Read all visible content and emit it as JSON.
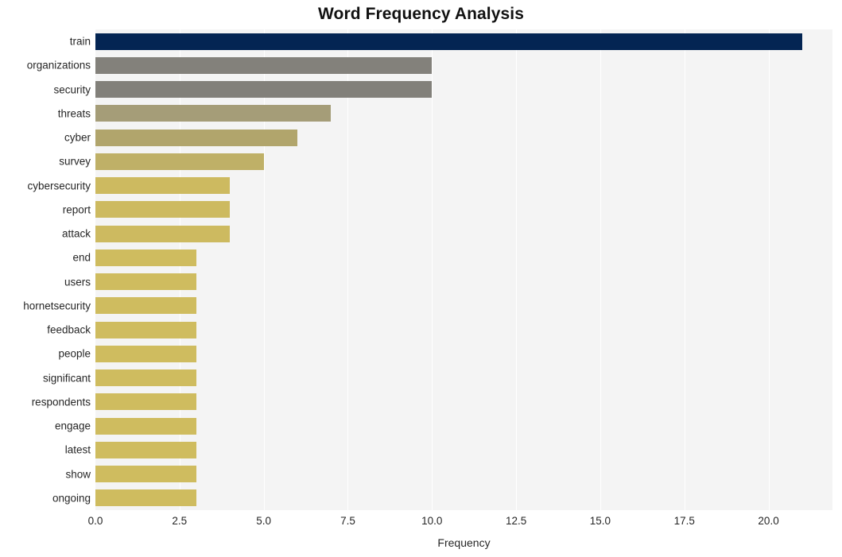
{
  "chart_data": {
    "type": "bar",
    "orientation": "horizontal",
    "title": "Word Frequency Analysis",
    "xlabel": "Frequency",
    "ylabel": "",
    "xlim": [
      0,
      21.9
    ],
    "xticks": [
      0.0,
      2.5,
      5.0,
      7.5,
      10.0,
      12.5,
      15.0,
      17.5,
      20.0
    ],
    "xtick_labels": [
      "0.0",
      "2.5",
      "5.0",
      "7.5",
      "10.0",
      "12.5",
      "15.0",
      "17.5",
      "20.0"
    ],
    "grid": true,
    "grid_axis": "x",
    "legend": false,
    "categories": [
      "train",
      "organizations",
      "security",
      "threats",
      "cyber",
      "survey",
      "cybersecurity",
      "report",
      "attack",
      "end",
      "users",
      "hornetsecurity",
      "feedback",
      "people",
      "significant",
      "respondents",
      "engage",
      "latest",
      "show",
      "ongoing"
    ],
    "values": [
      21,
      10,
      10,
      7,
      6,
      5,
      4,
      4,
      4,
      3,
      3,
      3,
      3,
      3,
      3,
      3,
      3,
      3,
      3,
      3
    ],
    "bar_colors": [
      "#042553",
      "#83817b",
      "#82807a",
      "#a59d78",
      "#b1a56c",
      "#bfb067",
      "#cdba60",
      "#cdba60",
      "#cdba60",
      "#cfbc5f",
      "#cfbc5f",
      "#cfbc5f",
      "#cfbc5f",
      "#cfbc5f",
      "#cfbc5f",
      "#cfbc5f",
      "#cfbc5f",
      "#cfbc5f",
      "#cfbc5f",
      "#cfbc5f"
    ],
    "plot_background": "#f4f4f4",
    "figure_background": "#ffffff",
    "gridline_color": "#ffffff"
  }
}
